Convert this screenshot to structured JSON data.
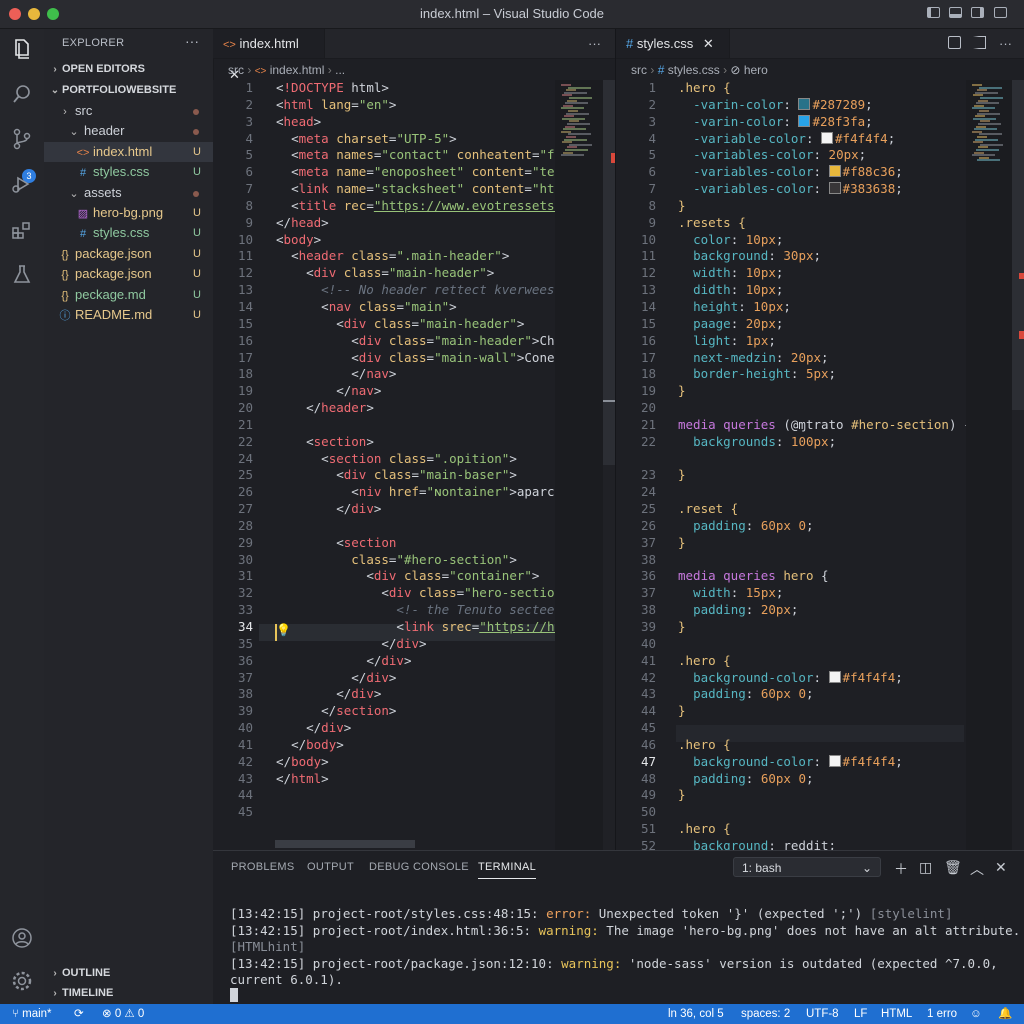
{
  "window": {
    "title": "index.html – Visual Studio Code"
  },
  "explorer": {
    "header": "EXPLORER",
    "open_editors": "OPEN EDITORS",
    "project": "PORTFOLIOWEBSITE",
    "tree": [
      {
        "label": "src",
        "icon": "›",
        "indent": 1
      },
      {
        "label": "header",
        "icon": "⌄",
        "indent": 2
      },
      {
        "label": "index.html",
        "icon": "<>",
        "indent": 3,
        "status": "U"
      },
      {
        "label": "styles.css",
        "icon": "#",
        "indent": 3,
        "status": "U"
      },
      {
        "label": "assets",
        "icon": "⌄",
        "indent": 2
      },
      {
        "label": "hero-bg.png",
        "icon": "▨",
        "indent": 3,
        "status": "U"
      },
      {
        "label": "styles.css",
        "icon": "#",
        "indent": 3,
        "status": "U"
      },
      {
        "label": "package.json",
        "icon": "{}",
        "indent": 1,
        "status": "U"
      },
      {
        "label": "package.json",
        "icon": "{}",
        "indent": 1,
        "status": "U"
      },
      {
        "label": "peckage.md",
        "icon": "{}",
        "indent": 1,
        "status": "U"
      },
      {
        "label": "README.md",
        "icon": "ⓘ",
        "indent": 1,
        "status": "U"
      }
    ],
    "outline": "OUTLINE",
    "timeline": "TIMELINE",
    "scm_badge": "3"
  },
  "left_editor": {
    "tab": "index.html",
    "breadcrumb": [
      "src",
      "index.html",
      "..."
    ],
    "lines": [
      "<!DOCTYPE html>",
      "<html lang=\"en\">",
      "<head>",
      "  <meta charset=\"UTP-5\">",
      "  <meta names=\"contact\" conheatent=\"f-br",
      "  <meta name=\"enoposheet\" content=\"text/",
      "  <link name=\"stacksheet\" content=\"https",
      "  <title rec=\"https://www.evotressets.or",
      "</head>",
      "<body>",
      "  <header class=\".main-header\">",
      "    <div class=\"main-header\">",
      "      <!-- No header rettect kverwees or",
      "      <nav class=\"main\">",
      "        <div class=\"main-header\">",
      "          <div class=\"main-header\">Chåår",
      "          <div class=\"main-wall\">Conerlr",
      "          </nav>",
      "        </nav>",
      "    </header>",
      "",
      "    <section>",
      "      <section class=\".opition\">",
      "        <div class=\"main-baser\">",
      "          <niv href=\"ɴontainer\">aparc/Ir",
      "        </div>",
      "",
      "        <section",
      "          class=\"#hero-section\">",
      "            <div class=\"container\">",
      "              <div class=\"hero-section\">",
      "                <!- the Tenuto sectee pr",
      "                <link srec=\"https://hero",
      "              </div>",
      "            </div>",
      "          </div>",
      "        </div>",
      "      </section>",
      "    </div>",
      "  </body>",
      "</body>",
      "</html>",
      "",
      ""
    ],
    "line_numbers": [
      "1",
      "2",
      "3",
      "4",
      "5",
      "6",
      "7",
      "8",
      "9",
      "10",
      "11",
      "12",
      "13",
      "14",
      "15",
      "16",
      "17",
      "18",
      "19",
      "20",
      "21",
      "22",
      "24",
      "25",
      "26",
      "27",
      "28",
      "29",
      "30",
      "31",
      "32",
      "33",
      "34",
      "35",
      "36",
      "37",
      "38",
      "39",
      "40",
      "41",
      "42",
      "43",
      "44",
      "45"
    ]
  },
  "right_editor": {
    "tab": "styles.css",
    "breadcrumb": [
      "src",
      "styles.css",
      "hero"
    ],
    "lines": [
      ".hero {",
      "  -varin-color: ■#287289;",
      "  -varin-color: ■#28f3fa;",
      "  -variable-color: ■#f4f4f4;",
      "  -variables-color: 20px;",
      "  -variables-color: ■#f88c36;",
      "  -variables-color: ■#383638;",
      "}",
      ".resets {",
      "  color: 10px;",
      "  background: 30px;",
      "  width: 10px;",
      "  didth: 10px;",
      "  height: 10px;",
      "  paage: 20px;",
      "  light: 1px;",
      "  next-medzin: 20px;",
      "  border-height: 5px;",
      "}",
      "",
      "media queries (@ɱtrato #hero-section) {",
      "  backgrounds: 100px;",
      "",
      "}",
      "",
      ".reset {",
      "  padding: 60px 0;",
      "}",
      "",
      "media queries hero {",
      "  width: 15px;",
      "  padding: 20px;",
      "}",
      "",
      ".hero {",
      "  background-color: ■#f4f4f4;",
      "  padding: 60px 0;",
      "}",
      "",
      ".hero {",
      "  background-color: ■#f4f4f4;",
      "  padding: 60px 0;",
      "}",
      "",
      ".hero {",
      "  background: reddit;"
    ],
    "line_numbers": [
      "1",
      "2",
      "3",
      "4",
      "5",
      "6",
      "7",
      "8",
      "9",
      "10",
      "11",
      "12",
      "13",
      "14",
      "15",
      "16",
      "17",
      "18",
      "19",
      "20",
      "21",
      "22",
      "",
      "23",
      "24",
      "25",
      "26",
      "37",
      "38",
      "36",
      "37",
      "38",
      "39",
      "40",
      "41",
      "42",
      "43",
      "44",
      "45",
      "46",
      "47",
      "48",
      "49",
      "50",
      "51",
      "52"
    ],
    "swatches": {
      "#287289": "#287289",
      "#28f3fa": "#28a3e8",
      "#f4f4f4": "#f4f4f4",
      "#f88c36": "#e8b83c",
      "#383638": "#383638"
    }
  },
  "panel": {
    "tabs": [
      "PROBLEMS",
      "OUTPUT",
      "DEBUG CONSOLE",
      "TERMINAL"
    ],
    "active_tab": "TERMINAL",
    "shell": "1: bash",
    "terminal": [
      {
        "time": "[13:42:15]",
        "path": " project-root/styles.css:48:15: ",
        "level": "error:",
        "msg": " Unexpected token '}' (expected ';') ",
        "src": "[stylelint]"
      },
      {
        "time": "[13:42:15]",
        "path": " project-root/index.html:36:5: ",
        "level": "warning:",
        "msg": " The image 'hero-bg.png' does not have an alt attribute.",
        "src": ""
      },
      {
        "time": "",
        "path": "",
        "level": "",
        "msg": "",
        "src": "[HTMLhint]"
      },
      {
        "time": "[13:42:15]",
        "path": " project-root/package.json:12:10: ",
        "level": "warning:",
        "msg": " 'node-sass' version is outdated (expected ^7.0.0,",
        "src": ""
      },
      {
        "time": "",
        "path": "current 6.0.1).",
        "level": "",
        "msg": "",
        "src": ""
      }
    ]
  },
  "statusbar": {
    "branch": "main*",
    "problems": "⊗ 0 ⚠ 0",
    "position": "ln 36, col 5",
    "spaces": "spaces: 2",
    "encoding": "UTF-8",
    "eol": "LF",
    "language": "HTML",
    "errors": "1 erro"
  }
}
